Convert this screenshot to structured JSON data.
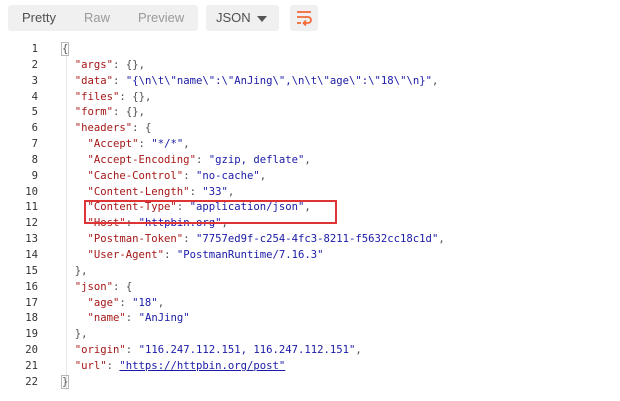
{
  "toolbar": {
    "tabs": [
      {
        "label": "Pretty",
        "active": true
      },
      {
        "label": "Raw",
        "active": false
      },
      {
        "label": "Preview",
        "active": false
      }
    ],
    "format": "JSON",
    "wrap_icon": "wrap-lines-icon",
    "accent_color": "#f26b3a"
  },
  "code": {
    "lines": [
      {
        "n": "1",
        "indent": "",
        "key": "",
        "sep": "",
        "value": "",
        "punct": "{",
        "is_url": false
      },
      {
        "n": "2",
        "indent": "  ",
        "key": "\"args\"",
        "sep": ": ",
        "value": "",
        "punct": "{},",
        "is_url": false
      },
      {
        "n": "3",
        "indent": "  ",
        "key": "\"data\"",
        "sep": ": ",
        "value": "\"{\\n\\t\\\"name\\\":\\\"AnJing\\\",\\n\\t\\\"age\\\":\\\"18\\\"\\n}\"",
        "punct": ",",
        "is_url": false
      },
      {
        "n": "4",
        "indent": "  ",
        "key": "\"files\"",
        "sep": ": ",
        "value": "",
        "punct": "{},",
        "is_url": false
      },
      {
        "n": "5",
        "indent": "  ",
        "key": "\"form\"",
        "sep": ": ",
        "value": "",
        "punct": "{},",
        "is_url": false
      },
      {
        "n": "6",
        "indent": "  ",
        "key": "\"headers\"",
        "sep": ": ",
        "value": "",
        "punct": "{",
        "is_url": false
      },
      {
        "n": "7",
        "indent": "    ",
        "key": "\"Accept\"",
        "sep": ": ",
        "value": "\"*/*\"",
        "punct": ",",
        "is_url": false
      },
      {
        "n": "8",
        "indent": "    ",
        "key": "\"Accept-Encoding\"",
        "sep": ": ",
        "value": "\"gzip, deflate\"",
        "punct": ",",
        "is_url": false
      },
      {
        "n": "9",
        "indent": "    ",
        "key": "\"Cache-Control\"",
        "sep": ": ",
        "value": "\"no-cache\"",
        "punct": ",",
        "is_url": false
      },
      {
        "n": "10",
        "indent": "    ",
        "key": "\"Content-Length\"",
        "sep": ": ",
        "value": "\"33\"",
        "punct": ",",
        "is_url": false
      },
      {
        "n": "11",
        "indent": "    ",
        "key": "\"Content-Type\"",
        "sep": ": ",
        "value": "\"application/json\"",
        "punct": ",",
        "is_url": false
      },
      {
        "n": "12",
        "indent": "    ",
        "key": "\"Host\"",
        "sep": ": ",
        "value": "\"httpbin.org\"",
        "punct": ",",
        "is_url": false
      },
      {
        "n": "13",
        "indent": "    ",
        "key": "\"Postman-Token\"",
        "sep": ": ",
        "value": "\"7757ed9f-c254-4fc3-8211-f5632cc18c1d\"",
        "punct": ",",
        "is_url": false
      },
      {
        "n": "14",
        "indent": "    ",
        "key": "\"User-Agent\"",
        "sep": ": ",
        "value": "\"PostmanRuntime/7.16.3\"",
        "punct": "",
        "is_url": false
      },
      {
        "n": "15",
        "indent": "  ",
        "key": "",
        "sep": "",
        "value": "",
        "punct": "},",
        "is_url": false
      },
      {
        "n": "16",
        "indent": "  ",
        "key": "\"json\"",
        "sep": ": ",
        "value": "",
        "punct": "{",
        "is_url": false
      },
      {
        "n": "17",
        "indent": "    ",
        "key": "\"age\"",
        "sep": ": ",
        "value": "\"18\"",
        "punct": ",",
        "is_url": false
      },
      {
        "n": "18",
        "indent": "    ",
        "key": "\"name\"",
        "sep": ": ",
        "value": "\"AnJing\"",
        "punct": "",
        "is_url": false
      },
      {
        "n": "19",
        "indent": "  ",
        "key": "",
        "sep": "",
        "value": "",
        "punct": "},",
        "is_url": false
      },
      {
        "n": "20",
        "indent": "  ",
        "key": "\"origin\"",
        "sep": ": ",
        "value": "\"116.247.112.151, 116.247.112.151\"",
        "punct": ",",
        "is_url": false
      },
      {
        "n": "21",
        "indent": "  ",
        "key": "\"url\"",
        "sep": ": ",
        "value": "\"https://httpbin.org/post\"",
        "punct": "",
        "is_url": true
      },
      {
        "n": "22",
        "indent": "",
        "key": "",
        "sep": "",
        "value": "",
        "punct": "}",
        "is_url": false
      }
    ],
    "highlighted_line": "11",
    "highlight_color": "#e03434"
  }
}
